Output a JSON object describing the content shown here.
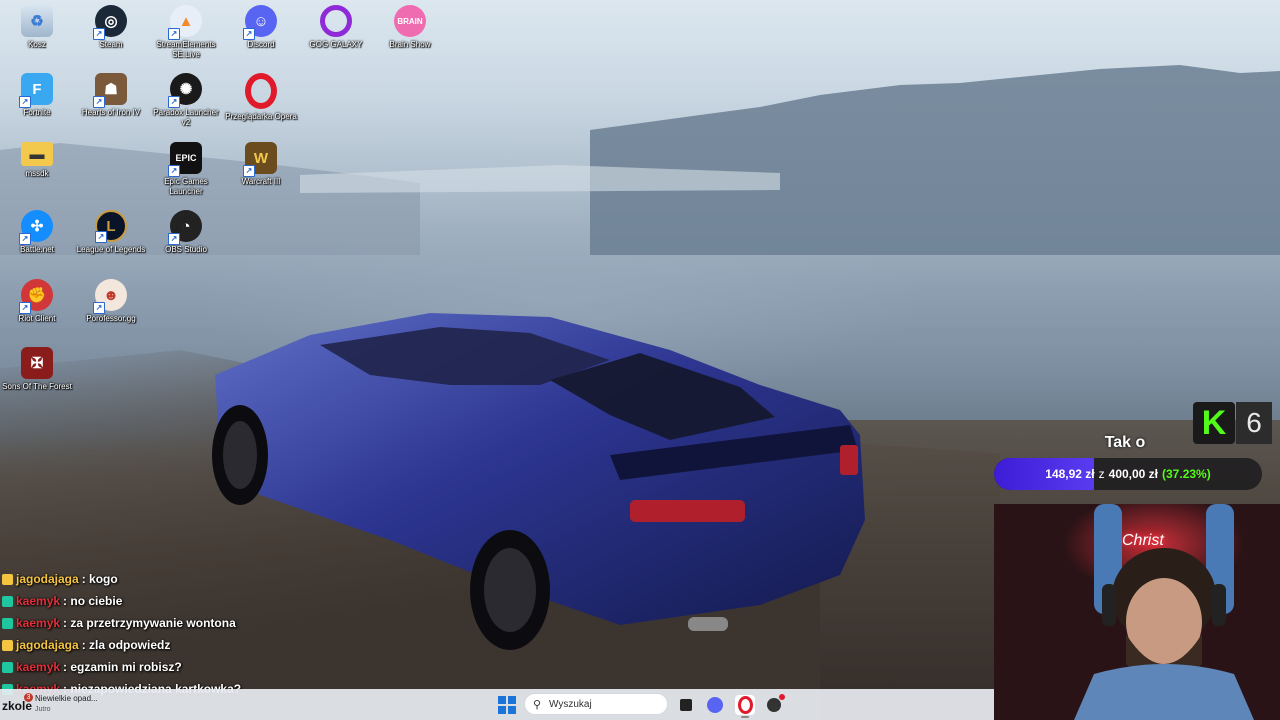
{
  "desktop_icons": [
    {
      "label": "Kosz",
      "icon": "recycle-bin-icon"
    },
    {
      "label": "Steam",
      "icon": "steam-icon"
    },
    {
      "label": "StreamElements SE.Live",
      "icon": "streamelements-icon"
    },
    {
      "label": "Discord",
      "icon": "discord-icon"
    },
    {
      "label": "GOG GALAXY",
      "icon": "gog-galaxy-icon"
    },
    {
      "label": "Brain Show",
      "icon": "brain-show-icon"
    },
    {
      "label": "Fortnite",
      "icon": "fortnite-icon"
    },
    {
      "label": "Hearts of Iron IV",
      "icon": "hearts-of-iron-icon"
    },
    {
      "label": "Paradox Launcher v2",
      "icon": "paradox-launcher-icon"
    },
    {
      "label": "Przeglądarka Opera",
      "icon": "opera-icon"
    },
    {
      "label": "mssdk",
      "icon": "folder-icon"
    },
    {
      "label": "Epic Games Launcher",
      "icon": "epic-games-icon"
    },
    {
      "label": "Warcraft III",
      "icon": "warcraft-icon"
    },
    {
      "label": "Battle.net",
      "icon": "battlenet-icon"
    },
    {
      "label": "League of Legends",
      "icon": "league-of-legends-icon"
    },
    {
      "label": "OBS Studio",
      "icon": "obs-studio-icon"
    },
    {
      "label": "Riot Client",
      "icon": "riot-client-icon"
    },
    {
      "label": "Porofessor.gg",
      "icon": "porofessor-icon"
    },
    {
      "label": "Sons Of The Forest",
      "icon": "sons-of-the-forest-icon"
    }
  ],
  "chat": [
    {
      "user": "jagodajaga",
      "text": ": kogo",
      "color": "#f5c542"
    },
    {
      "user": "kaemyk",
      "text": ": no ciebie",
      "color": "#e0303a"
    },
    {
      "user": "kaemyk",
      "text": ": za przetrzymywanie wontona",
      "color": "#e0303a"
    },
    {
      "user": "jagodajaga",
      "text": ": zla odpowiedz",
      "color": "#f5c542"
    },
    {
      "user": "kaemyk",
      "text": ": egzamin mi robisz?",
      "color": "#e0303a"
    },
    {
      "user": "kaemyk",
      "text": ": niezapowiedziana kartkowka?",
      "color": "#e0303a"
    }
  ],
  "goal": {
    "kick_logo": "K",
    "count": "6",
    "title": "Tak o",
    "current": "148,92 zł",
    "separator": "z",
    "target": "400,00 zł",
    "percent_text": "(37.23%)",
    "progress": 0.3723
  },
  "webcam": {
    "neon_text": "Christ"
  },
  "taskbar": {
    "weather_temp": "zkole",
    "weather_badge": "3",
    "weather_line1": "Niewielkie opad...",
    "weather_line2": "Jutro",
    "search_placeholder": "Wyszukaj"
  },
  "colors": {
    "kick_green": "#53fc18",
    "goal_fill": "#4a2ce6"
  }
}
